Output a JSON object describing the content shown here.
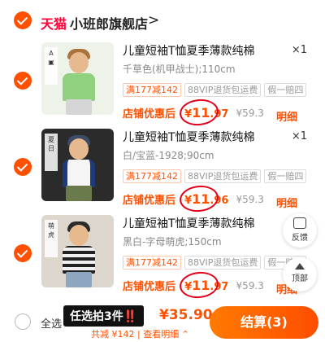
{
  "store": {
    "brand": "天猫",
    "name": "小班郎旗舰店",
    "chevron": ">"
  },
  "items": [
    {
      "title": "儿童短袖T恤夏季薄款纯棉",
      "qty": "×1",
      "sku": "千草色(机甲战士);110cm",
      "tags": [
        "满177减142",
        "88VIP退货包运费",
        "假一赔四"
      ],
      "price_label": "店铺优惠后",
      "price_symbol": "¥",
      "price_int": "11",
      "price_dec": ".97",
      "orig_price": "¥59.3",
      "detail": "明细",
      "thumb_color": "#8fd17f"
    },
    {
      "title": "儿童短袖T恤夏季薄款纯棉",
      "qty": "×1",
      "sku": "白/宝蓝-1928;90cm",
      "tags": [
        "满177减142",
        "88VIP退货包运费",
        "假一赔四"
      ],
      "price_label": "店铺优惠后",
      "price_symbol": "¥",
      "price_int": "11",
      "price_dec": ".96",
      "orig_price": "¥59.3",
      "detail": "明细",
      "thumb_color": "#f5f5f5"
    },
    {
      "title": "儿童短袖T恤夏季薄款纯棉",
      "qty": "×1",
      "sku": "黑白-字母萌虎;150cm",
      "tags": [
        "满177减142",
        "88VIP退货包运费",
        "假一赔四"
      ],
      "price_label": "店铺优惠后",
      "price_symbol": "¥",
      "price_int": "11",
      "price_dec": ".97",
      "orig_price": "¥59.3",
      "detail": "明细",
      "thumb_color": "#e8e8e8"
    }
  ],
  "float": {
    "feedback": "反馈",
    "top": "顶部"
  },
  "bottom": {
    "select_all": "全选",
    "banner": "任选拍3件‼️",
    "total": "¥35.90",
    "saved": "共减 ¥142 | 查看明细 ⌃",
    "checkout": "结算(3)"
  },
  "colors": {
    "accent": "#ff5000",
    "tmall": "#ff0036"
  },
  "icons": [
    "checkmark-icon",
    "chevron-right-icon",
    "feedback-icon",
    "arrow-up-icon"
  ]
}
